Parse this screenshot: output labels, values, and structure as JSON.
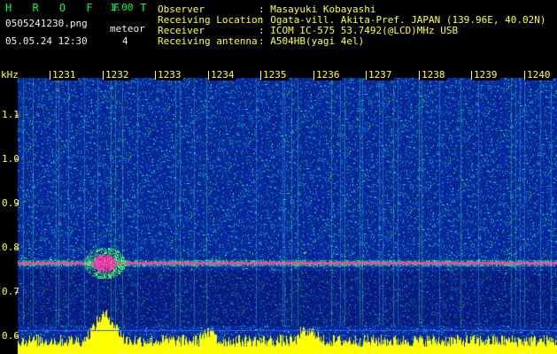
{
  "header": {
    "app_name": "H R O F F T",
    "version": "1.00",
    "filename": "0505241230.png",
    "timestamp": "05.05.24 12:30",
    "meteor_label": "meteor",
    "meteor_count": "4",
    "fields": [
      {
        "label": "Observer",
        "value": ": Masayuki Kobayashi"
      },
      {
        "label": "Receiving Location",
        "value": ": Ogata-vill. Akita-Pref. JAPAN (139.96E, 40.02N)"
      },
      {
        "label": "Receiver",
        "value": ": ICOM IC-575 53.7492(@LCD)MHz USB"
      },
      {
        "label": "Receiving antenna",
        "value": ": A504HB(yagi 4el)"
      }
    ]
  },
  "axis": {
    "unit": "kHz",
    "y_ticks": [
      "1.1",
      "1.0",
      "0.9",
      "0.8",
      "0.7",
      "0.6"
    ],
    "minutes": [
      "1231",
      "1232",
      "1233",
      "1234",
      "1235",
      "1236",
      "1237",
      "1238",
      "1239",
      "1240"
    ]
  },
  "colors": {
    "background_spectrum": "#0a1a8c",
    "carrier": "#ff3aa8",
    "level": "#ffff00",
    "accent": "#ffff3c",
    "title": "#00ff3c"
  }
}
